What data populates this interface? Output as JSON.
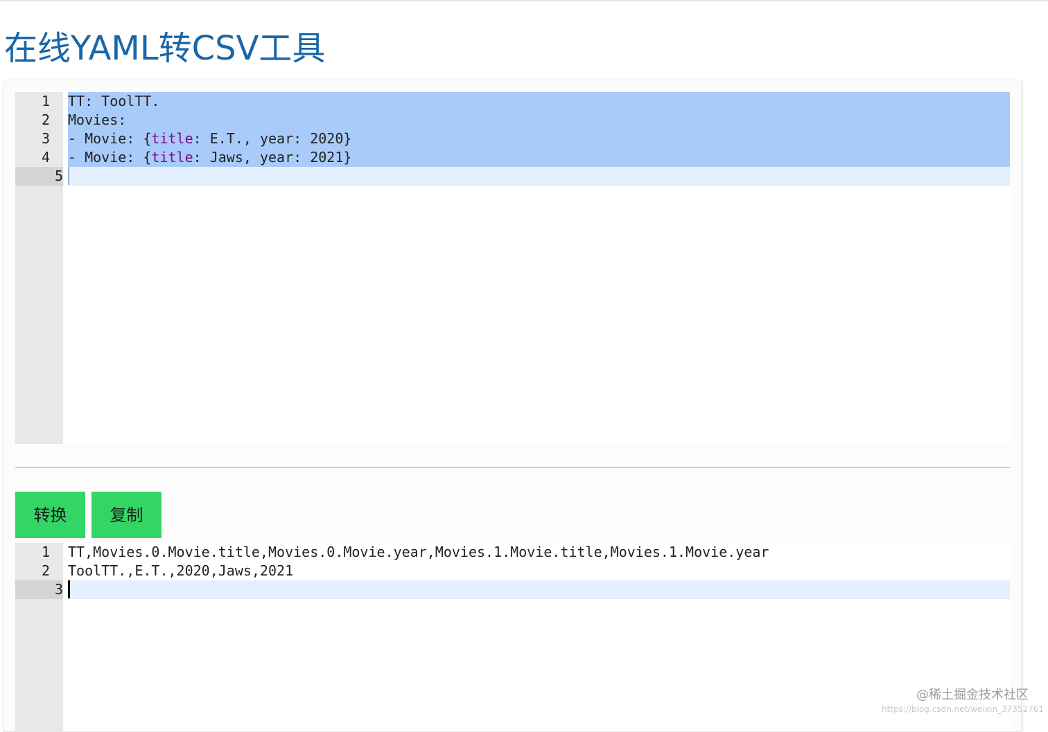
{
  "page": {
    "title": "在线YAML转CSV工具"
  },
  "input_editor": {
    "lines": [
      {
        "number": "1",
        "text": "TT: ToolTT."
      },
      {
        "number": "2",
        "text": "Movies:"
      },
      {
        "number": "3",
        "pre": "- Movie: {",
        "kw": "title",
        "post": ": E.T., year: 2020}"
      },
      {
        "number": "4",
        "pre": "- Movie: {",
        "kw": "title",
        "post": ": Jaws, year: 2021}"
      },
      {
        "number": "5",
        "text": ""
      }
    ]
  },
  "buttons": {
    "convert_label": "转换",
    "copy_label": "复制"
  },
  "output_editor": {
    "lines": [
      {
        "number": "1",
        "text": "TT,Movies.0.Movie.title,Movies.0.Movie.year,Movies.1.Movie.title,Movies.1.Movie.year"
      },
      {
        "number": "2",
        "text": "ToolTT.,E.T.,2020,Jaws,2021"
      },
      {
        "number": "3",
        "text": ""
      }
    ]
  },
  "watermark": {
    "text": "@稀土掘金技术社区",
    "url": "https://blog.csdn.net/weixin_37352761"
  },
  "colors": {
    "title": "#1a66a8",
    "button": "#33d565",
    "selection": "#a9cbfa",
    "keyword": "#7d0e84"
  }
}
